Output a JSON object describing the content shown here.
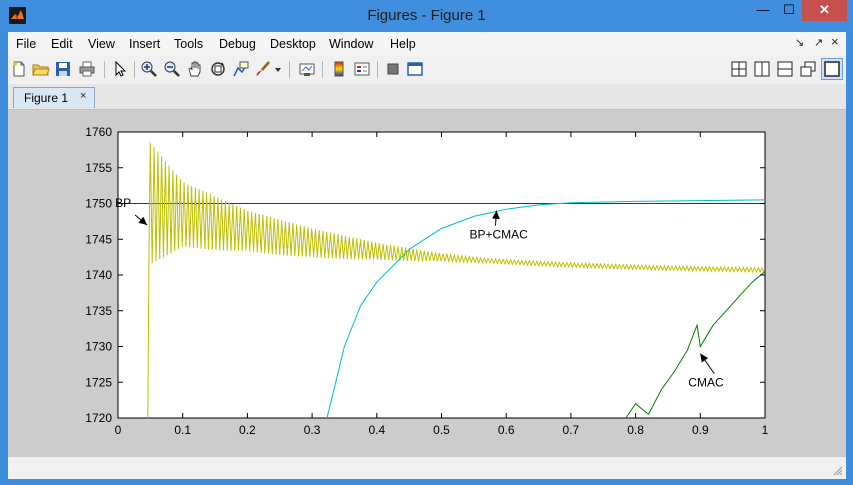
{
  "window": {
    "title": "Figures - Figure 1",
    "min_label": "—",
    "max_label": "☐",
    "close_label": "✕"
  },
  "menu": {
    "items": [
      "File",
      "Edit",
      "View",
      "Insert",
      "Tools",
      "Debug",
      "Desktop",
      "Window",
      "Help"
    ],
    "undock_label": "↘",
    "dock_label": "↗",
    "close_label": "×"
  },
  "toolbar": {
    "icons": [
      "new-figure-icon",
      "open-file-icon",
      "save-icon",
      "print-icon",
      "pointer-icon",
      "zoom-in-icon",
      "zoom-out-icon",
      "pan-hand-icon",
      "rotate-3d-icon",
      "data-cursor-icon",
      "brush-icon",
      "dropdown-arrow-icon",
      "link-plot-icon",
      "colorbar-icon",
      "legend-icon",
      "hide-plot-tools-icon",
      "show-plot-tools-icon"
    ],
    "layout_icons": [
      "tile-grid-icon",
      "tile-left-right-icon",
      "tile-top-bottom-icon",
      "float-icon",
      "maximize-icon"
    ]
  },
  "tabs": [
    {
      "label": "Figure 1",
      "close": "×"
    }
  ],
  "colors": {
    "title_bar": "#3f8fde",
    "close_button": "#c7504f",
    "series_bp": "#bfbf00",
    "series_bp_cmac": "#00bfbf",
    "series_cmac": "#007f00",
    "reference": "#7f007f"
  },
  "chart_data": {
    "type": "line",
    "xlim": [
      0,
      1
    ],
    "ylim": [
      1720,
      1760
    ],
    "xticks": [
      "0",
      "0.1",
      "0.2",
      "0.3",
      "0.4",
      "0.5",
      "0.6",
      "0.7",
      "0.8",
      "0.9",
      "1"
    ],
    "yticks": [
      "1720",
      "1725",
      "1730",
      "1735",
      "1740",
      "1745",
      "1750",
      "1755",
      "1760"
    ],
    "grid": false,
    "series": [
      {
        "values": [
          [
            0,
            1750
          ],
          [
            1,
            1750
          ]
        ]
      },
      {
        "values": [
          [
            0.323,
            1720
          ],
          [
            0.35,
            1730
          ],
          [
            0.375,
            1735.7
          ],
          [
            0.4,
            1739
          ],
          [
            0.45,
            1743.6
          ],
          [
            0.5,
            1746.5
          ],
          [
            0.55,
            1748.2
          ],
          [
            0.6,
            1749.2
          ],
          [
            0.65,
            1749.8
          ],
          [
            0.7,
            1750.1
          ],
          [
            0.8,
            1750.3
          ],
          [
            0.9,
            1750.4
          ],
          [
            1,
            1750.5
          ]
        ]
      },
      {
        "values": [
          [
            0.045,
            1720
          ],
          [
            0.05,
            1758.5
          ],
          [
            0.1,
            1753
          ],
          [
            0.2,
            1749
          ],
          [
            0.3,
            1746.5
          ],
          [
            0.4,
            1744.5
          ],
          [
            0.5,
            1743
          ],
          [
            0.6,
            1742
          ],
          [
            0.7,
            1741.5
          ],
          [
            0.8,
            1741
          ],
          [
            0.9,
            1741
          ],
          [
            1,
            1740.5
          ]
        ]
      },
      {
        "values": [
          [
            0.785,
            1720
          ],
          [
            0.8,
            1722
          ],
          [
            0.82,
            1720.5
          ],
          [
            0.84,
            1724
          ],
          [
            0.86,
            1726.5
          ],
          [
            0.88,
            1729.5
          ],
          [
            0.895,
            1733
          ],
          [
            0.9,
            1730
          ],
          [
            0.92,
            1733
          ],
          [
            0.94,
            1735
          ],
          [
            0.96,
            1737
          ],
          [
            0.98,
            1739
          ],
          [
            1,
            1740.5
          ]
        ]
      }
    ],
    "annotations": [
      {
        "text": "BP",
        "x": 0.045,
        "y": 1747
      },
      {
        "text": "BP+CMAC",
        "x": 0.585,
        "y": 1749
      },
      {
        "text": "CMAC",
        "x": 0.9,
        "y": 1729
      }
    ]
  }
}
